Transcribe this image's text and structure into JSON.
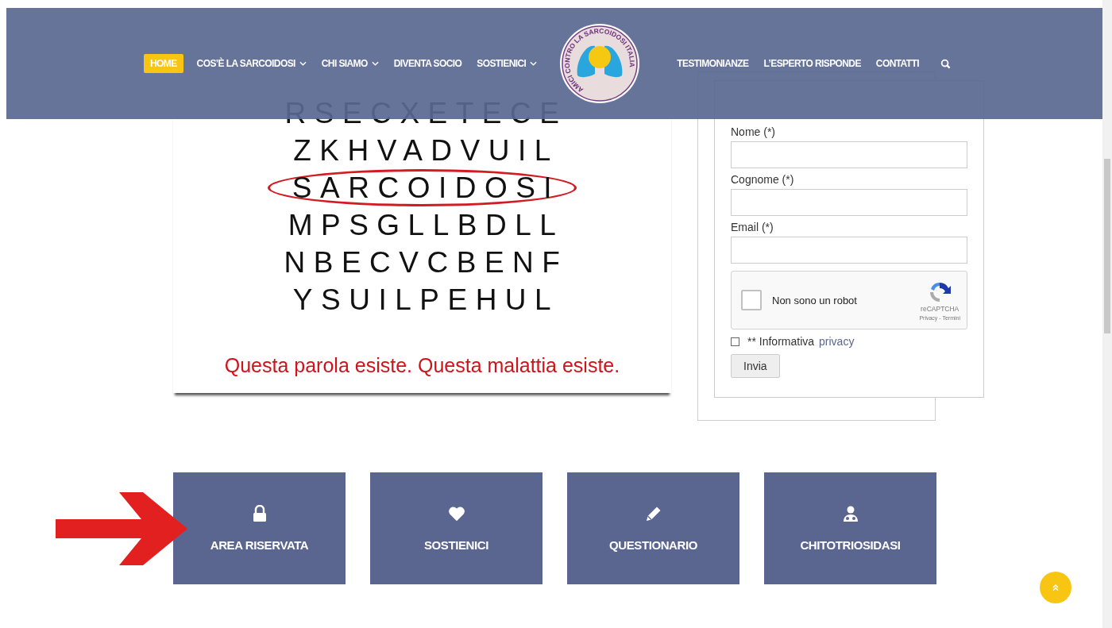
{
  "nav": {
    "items_left": [
      {
        "label": "HOME",
        "selected": true,
        "dropdown": false
      },
      {
        "label": "COS’È LA SARCOIDOSI",
        "selected": false,
        "dropdown": true
      },
      {
        "label": "CHI SIAMO",
        "selected": false,
        "dropdown": true
      },
      {
        "label": "DIVENTA SOCIO",
        "selected": false,
        "dropdown": false
      },
      {
        "label": "SOSTIENICI",
        "selected": false,
        "dropdown": true
      }
    ],
    "logo": {
      "text": "AMICI CONTRO LA SARCOIDOSI ITALIA"
    },
    "items_right": [
      {
        "label": "TESTIMONIANZE",
        "selected": false,
        "dropdown": false
      },
      {
        "label": "L’ESPERTO RISPONDE",
        "selected": false,
        "dropdown": false
      },
      {
        "label": "CONTATTI",
        "selected": false,
        "dropdown": false
      }
    ]
  },
  "puzzle": {
    "rows": [
      {
        "letters": "RSECXETECE",
        "circled": false
      },
      {
        "letters": "ZKHVADVUIL",
        "circled": false
      },
      {
        "letters": "SARCOIDOSI",
        "circled": true
      },
      {
        "letters": "MPSGLLBDLL",
        "circled": false
      },
      {
        "letters": "NBECVCBENF",
        "circled": false
      },
      {
        "letters": "YSUILPEHUL",
        "circled": false
      }
    ],
    "tagline": "Questa parola esiste. Questa malattia esiste."
  },
  "newsletter": {
    "fields": [
      {
        "label": "Nome (*)"
      },
      {
        "label": "Cognome (*)"
      },
      {
        "label": "Email (*)"
      }
    ],
    "captcha": {
      "label": "Non sono un robot",
      "checked": false,
      "brand": "reCAPTCHA",
      "links": "Privacy - Termini"
    },
    "consent": {
      "checked": false,
      "text": "** Informativa",
      "link": "privacy"
    },
    "submit": "Invia"
  },
  "tiles": [
    {
      "kind": "lock",
      "label": "AREA RISERVATA"
    },
    {
      "kind": "heart",
      "label": "SOSTIENICI"
    },
    {
      "kind": "pencil",
      "label": "QUESTIONARIO"
    },
    {
      "kind": "doctor",
      "label": "CHITOTRIOSIDASI"
    }
  ]
}
